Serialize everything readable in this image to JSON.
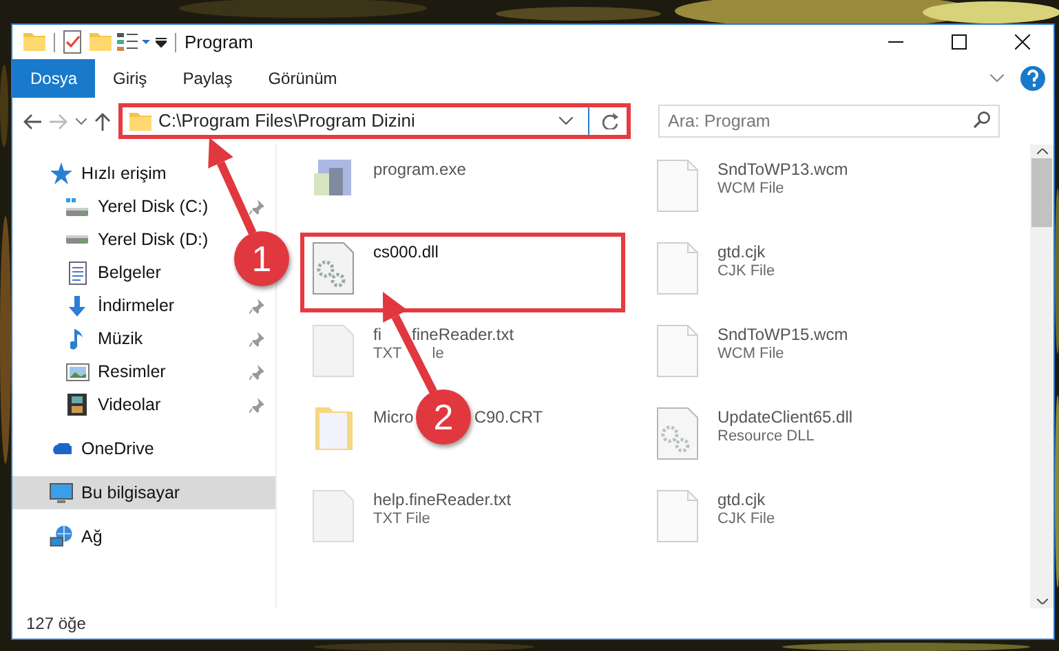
{
  "window": {
    "title": "Program"
  },
  "ribbon": {
    "tabs": [
      {
        "label": "Dosya",
        "selected": true
      },
      {
        "label": "Giriş",
        "selected": false
      },
      {
        "label": "Paylaş",
        "selected": false
      },
      {
        "label": "Görünüm",
        "selected": false
      }
    ]
  },
  "address": {
    "path": "C:\\Program Files\\Program Dizini",
    "marked": true
  },
  "search": {
    "placeholder": "Ara: Program"
  },
  "sidebar": {
    "items": [
      {
        "label": "Hızlı erişim",
        "kind": "star",
        "selected": false,
        "pinned": false,
        "children": [
          {
            "label": "Yerel Disk (C:)",
            "kind": "drive-win",
            "selected": false,
            "pinned": true
          },
          {
            "label": "Yerel Disk (D:)",
            "kind": "drive",
            "selected": false
          },
          {
            "label": "Belgeler",
            "kind": "docs",
            "selected": false
          },
          {
            "label": "İndirmeler",
            "kind": "download",
            "selected": false,
            "pinned": true
          },
          {
            "label": "Müzik",
            "kind": "music",
            "selected": false,
            "pinned": true
          },
          {
            "label": "Resimler",
            "kind": "pictures",
            "selected": false,
            "pinned": true
          },
          {
            "label": "Videolar",
            "kind": "videos",
            "selected": false,
            "pinned": true
          }
        ]
      },
      {
        "label": "OneDrive",
        "kind": "cloud",
        "selected": false,
        "pinned": false
      },
      {
        "label": "Bu bilgisayar",
        "kind": "pc",
        "selected": true,
        "pinned": false
      },
      {
        "label": "Ağ",
        "kind": "network",
        "selected": false,
        "pinned": false
      }
    ]
  },
  "files": [
    {
      "name_parts": [
        "program.exe"
      ],
      "kind": "exe",
      "dimmed": true,
      "marked": false
    },
    {
      "name_parts": [
        "SndToWP13.wcm"
      ],
      "type_parts": [
        "WCM File"
      ],
      "kind": "file",
      "dimmed": true,
      "marked": false
    },
    {
      "name_parts": [
        "cs000.dll"
      ],
      "kind": "dll",
      "dimmed": false,
      "marked": true
    },
    {
      "name_parts": [
        "gtd.cjk"
      ],
      "type_parts": [
        "CJK File"
      ],
      "kind": "file",
      "dimmed": true,
      "marked": false
    },
    {
      "name_parts": [
        "fi",
        "fineReader.txt"
      ],
      "type_parts": [
        "TXT",
        "le"
      ],
      "kind": "txt",
      "dimmed": true,
      "marked": false
    },
    {
      "name_parts": [
        "SndToWP15.wcm"
      ],
      "type_parts": [
        "WCM File"
      ],
      "kind": "file",
      "dimmed": true,
      "marked": false
    },
    {
      "name_parts": [
        "Micro",
        "C90.CRT"
      ],
      "kind": "folder",
      "dimmed": true,
      "marked": false
    },
    {
      "name_parts": [
        "UpdateClient65.dll"
      ],
      "type_parts": [
        "Resource DLL"
      ],
      "kind": "dll",
      "dimmed": true,
      "marked": false
    },
    {
      "name_parts": [
        "help.fineReader.txt"
      ],
      "type_parts": [
        "TXT File"
      ],
      "kind": "txt",
      "dimmed": true,
      "marked": false
    },
    {
      "name_parts": [
        "gtd.cjk"
      ],
      "type_parts": [
        "CJK File"
      ],
      "kind": "file",
      "dimmed": true,
      "marked": false
    }
  ],
  "callouts": [
    {
      "number": "1"
    },
    {
      "number": "2"
    }
  ],
  "status_bar": {
    "count": "127 öğe"
  }
}
